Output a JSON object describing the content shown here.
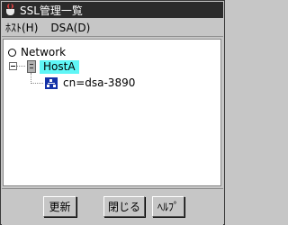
{
  "window": {
    "title": "SSL管理一覧"
  },
  "menu": [
    {
      "label": "ﾎｽﾄ(H)"
    },
    {
      "label": "DSA(D)"
    }
  ],
  "tree": {
    "root": "Network",
    "host": "HostA",
    "dsa": "cn=dsa-3890"
  },
  "buttons": {
    "refresh": "更新",
    "close": "閉じる",
    "help": "ﾍﾙﾌﾟ"
  },
  "colors": {
    "selection": "#5ff6f6",
    "dsa_icon": "#1432a8",
    "titlebar": "#2b2b2b"
  }
}
